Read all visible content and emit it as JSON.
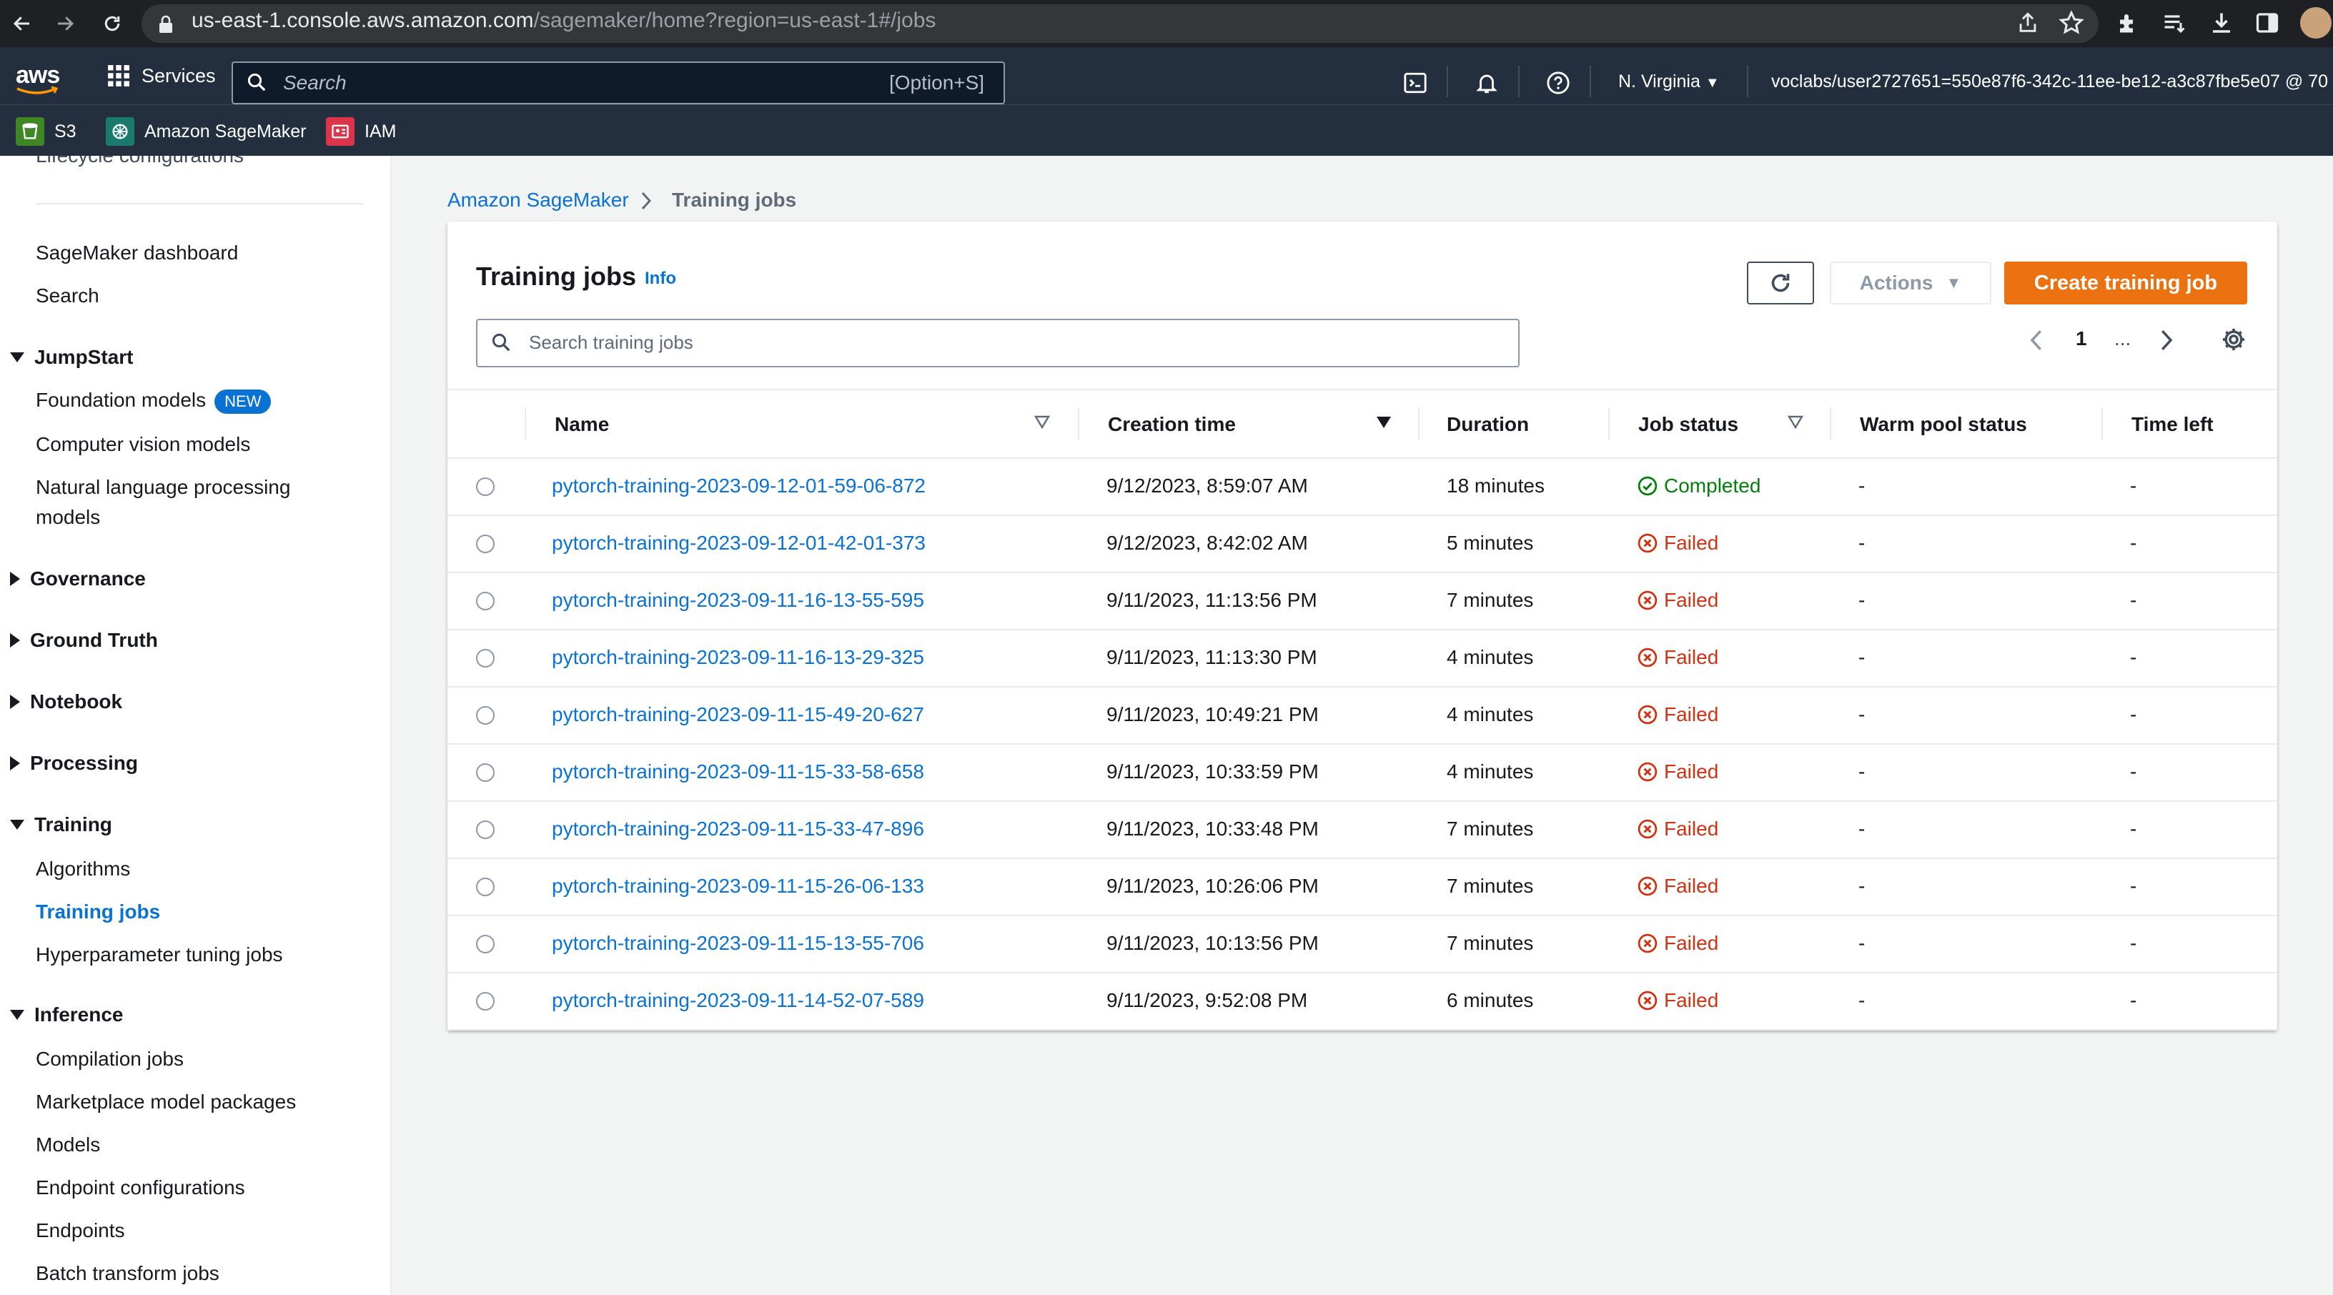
{
  "browser": {
    "url_host": "us-east-1.console.aws.amazon.com",
    "url_path": "/sagemaker/home?region=us-east-1#/jobs"
  },
  "aws_nav": {
    "logo": "aws",
    "services_label": "Services",
    "search_placeholder": "Search",
    "search_shortcut": "[Option+S]",
    "region": "N. Virginia",
    "account": "voclabs/user2727651=550e87f6-342c-11ee-be12-a3c87fbe5e07 @ 70"
  },
  "favorites": [
    {
      "label": "S3",
      "icon": "s3-icon",
      "color": "#3f8624"
    },
    {
      "label": "Amazon SageMaker",
      "icon": "sagemaker-icon",
      "color": "#1a7a6d"
    },
    {
      "label": "IAM",
      "icon": "iam-icon",
      "color": "#dd344c"
    }
  ],
  "sidebar": {
    "partial_item": "Lifecycle configurations",
    "top_items": [
      "SageMaker dashboard",
      "Search"
    ],
    "jumpstart": {
      "title": "JumpStart",
      "items": [
        "Foundation models",
        "Computer vision models",
        "Natural language processing",
        "models"
      ],
      "new_badge": "NEW"
    },
    "collapsed_sections": [
      "Governance",
      "Ground Truth",
      "Notebook",
      "Processing"
    ],
    "training": {
      "title": "Training",
      "items": [
        "Algorithms",
        "Training jobs",
        "Hyperparameter tuning jobs"
      ]
    },
    "inference": {
      "title": "Inference",
      "items": [
        "Compilation jobs",
        "Marketplace model packages",
        "Models",
        "Endpoint configurations",
        "Endpoints",
        "Batch transform jobs"
      ]
    }
  },
  "breadcrumb": {
    "root": "Amazon SageMaker",
    "current": "Training jobs"
  },
  "panel": {
    "title": "Training jobs",
    "info": "Info",
    "actions_label": "Actions",
    "create_label": "Create training job",
    "search_placeholder": "Search training jobs",
    "page": "1",
    "ellipsis": "..."
  },
  "table": {
    "headers": {
      "name": "Name",
      "creation_time": "Creation time",
      "duration": "Duration",
      "job_status": "Job status",
      "warm_pool": "Warm pool status",
      "time_left": "Time left"
    },
    "rows": [
      {
        "name": "pytorch-training-2023-09-12-01-59-06-872",
        "created": "9/12/2023, 8:59:07 AM",
        "duration": "18 minutes",
        "status": "Completed",
        "warm": "-",
        "left": "-"
      },
      {
        "name": "pytorch-training-2023-09-12-01-42-01-373",
        "created": "9/12/2023, 8:42:02 AM",
        "duration": "5 minutes",
        "status": "Failed",
        "warm": "-",
        "left": "-"
      },
      {
        "name": "pytorch-training-2023-09-11-16-13-55-595",
        "created": "9/11/2023, 11:13:56 PM",
        "duration": "7 minutes",
        "status": "Failed",
        "warm": "-",
        "left": "-"
      },
      {
        "name": "pytorch-training-2023-09-11-16-13-29-325",
        "created": "9/11/2023, 11:13:30 PM",
        "duration": "4 minutes",
        "status": "Failed",
        "warm": "-",
        "left": "-"
      },
      {
        "name": "pytorch-training-2023-09-11-15-49-20-627",
        "created": "9/11/2023, 10:49:21 PM",
        "duration": "4 minutes",
        "status": "Failed",
        "warm": "-",
        "left": "-"
      },
      {
        "name": "pytorch-training-2023-09-11-15-33-58-658",
        "created": "9/11/2023, 10:33:59 PM",
        "duration": "4 minutes",
        "status": "Failed",
        "warm": "-",
        "left": "-"
      },
      {
        "name": "pytorch-training-2023-09-11-15-33-47-896",
        "created": "9/11/2023, 10:33:48 PM",
        "duration": "7 minutes",
        "status": "Failed",
        "warm": "-",
        "left": "-"
      },
      {
        "name": "pytorch-training-2023-09-11-15-26-06-133",
        "created": "9/11/2023, 10:26:06 PM",
        "duration": "7 minutes",
        "status": "Failed",
        "warm": "-",
        "left": "-"
      },
      {
        "name": "pytorch-training-2023-09-11-15-13-55-706",
        "created": "9/11/2023, 10:13:56 PM",
        "duration": "7 minutes",
        "status": "Failed",
        "warm": "-",
        "left": "-"
      },
      {
        "name": "pytorch-training-2023-09-11-14-52-07-589",
        "created": "9/11/2023, 9:52:08 PM",
        "duration": "6 minutes",
        "status": "Failed",
        "warm": "-",
        "left": "-"
      }
    ]
  },
  "colors": {
    "accent": "#0972d3",
    "primary_button": "#ec7211",
    "success": "#037f0c",
    "error": "#d13212",
    "nav_bg": "#232f3e"
  }
}
